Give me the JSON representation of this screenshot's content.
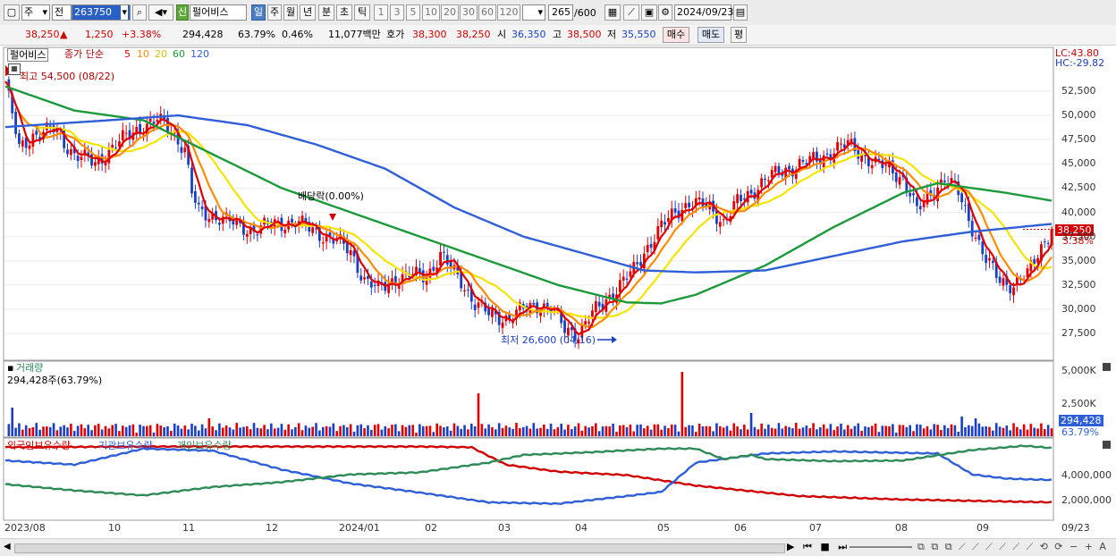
{
  "toolbar": {
    "period_label": "주",
    "prev_label": "전",
    "stock_code": "263750",
    "market_badge": "신",
    "stock_name": "펄어비스",
    "periods": [
      "일",
      "주",
      "월",
      "년",
      "분",
      "초",
      "틱"
    ],
    "numbers": [
      "1",
      "3",
      "5",
      "10",
      "20",
      "30",
      "60",
      "120"
    ],
    "count": "265",
    "count_total": "/600",
    "date": "2024/09/23"
  },
  "quote": {
    "price": "38,250",
    "change": "1,250",
    "change_pct": "+3.38%",
    "volume": "294,428",
    "vol_ratio": "63.79%",
    "turnover": "0.46%",
    "amount": "11,077백만",
    "ask_label": "호가",
    "ask1": "38,300",
    "ask2": "38,250",
    "open_label": "시",
    "open": "36,350",
    "high_label": "고",
    "high": "38,500",
    "low_label": "저",
    "low": "35,550",
    "buy": "매수",
    "sell": "매도",
    "avg": "평"
  },
  "legend": {
    "name": "펄어비스",
    "ma_label": "종가 단순",
    "ma": [
      {
        "period": "5",
        "color": "#e00000"
      },
      {
        "period": "10",
        "color": "#ff8c00"
      },
      {
        "period": "20",
        "color": "#e6d800"
      },
      {
        "period": "60",
        "color": "#1a9a3a"
      },
      {
        "period": "120",
        "color": "#2f5fd8"
      }
    ]
  },
  "annotations": {
    "high": "최고 54,500 (08/22)",
    "low": "최저 26,600 (04/16)",
    "dividend": "배당락(0.00%)",
    "lc": "LC:43.80",
    "hc": "HC:-29.82",
    "cur_price": "38,250",
    "cur_pct": "3.38%"
  },
  "volume_panel": {
    "title": "거래량",
    "value": "294,428주(63.79%)",
    "cur": "294,428",
    "cur_pct": "63.79%",
    "ticks": [
      "5,000K",
      "2,500K"
    ]
  },
  "holdings_panel": {
    "series": [
      {
        "name": "외국인보유수량",
        "color": "#d00000"
      },
      {
        "name": "기관보유수량",
        "color": "#2f5fd8"
      },
      {
        "name": "개인보유수량",
        "color": "#2e8b57"
      }
    ],
    "ticks": [
      "4,000,000",
      "2,000,000"
    ]
  },
  "chart_data": {
    "type": "candlestick",
    "y_ticks": [
      "52,500",
      "50,000",
      "47,500",
      "45,000",
      "42,500",
      "40,000",
      "37,500",
      "35,000",
      "32,500",
      "30,000",
      "27,500"
    ],
    "ylim": [
      25500,
      55000
    ],
    "x_ticks": [
      "2023/08",
      "10",
      "11",
      "12",
      "2024/01",
      "02",
      "03",
      "04",
      "05",
      "06",
      "07",
      "08",
      "09",
      "09/23"
    ],
    "series": [
      {
        "name": "종가",
        "points": [
          [
            0,
            53500
          ],
          [
            4,
            46500
          ],
          [
            8,
            48000
          ],
          [
            14,
            48500
          ],
          [
            20,
            46000
          ],
          [
            26,
            45000
          ],
          [
            32,
            47000
          ],
          [
            38,
            48500
          ],
          [
            44,
            49500
          ],
          [
            48,
            48500
          ],
          [
            52,
            46500
          ],
          [
            54,
            42000
          ],
          [
            56,
            40000
          ],
          [
            62,
            39500
          ],
          [
            68,
            38500
          ],
          [
            72,
            38200
          ],
          [
            78,
            38800
          ],
          [
            84,
            39000
          ],
          [
            90,
            38000
          ],
          [
            96,
            37000
          ],
          [
            100,
            36000
          ],
          [
            104,
            33000
          ],
          [
            108,
            32000
          ],
          [
            112,
            33000
          ],
          [
            118,
            33500
          ],
          [
            122,
            33500
          ],
          [
            126,
            35500
          ],
          [
            132,
            33000
          ],
          [
            136,
            30500
          ],
          [
            140,
            29500
          ],
          [
            146,
            29000
          ],
          [
            150,
            30000
          ],
          [
            154,
            30500
          ],
          [
            158,
            30000
          ],
          [
            162,
            28000
          ],
          [
            166,
            27500
          ],
          [
            170,
            29500
          ],
          [
            174,
            31000
          ],
          [
            178,
            32500
          ],
          [
            182,
            34000
          ],
          [
            186,
            36500
          ],
          [
            190,
            38500
          ],
          [
            194,
            40000
          ],
          [
            198,
            41000
          ],
          [
            204,
            40500
          ],
          [
            208,
            39000
          ],
          [
            212,
            41000
          ],
          [
            216,
            42000
          ],
          [
            220,
            43500
          ],
          [
            224,
            44000
          ],
          [
            230,
            45000
          ],
          [
            236,
            45500
          ],
          [
            240,
            46500
          ],
          [
            244,
            47000
          ],
          [
            248,
            46000
          ],
          [
            252,
            45000
          ],
          [
            256,
            44500
          ],
          [
            260,
            43500
          ],
          [
            262,
            42000
          ],
          [
            264,
            40000
          ],
          [
            268,
            42000
          ],
          [
            272,
            43500
          ],
          [
            276,
            42000
          ],
          [
            280,
            38500
          ],
          [
            284,
            35000
          ],
          [
            288,
            33000
          ],
          [
            292,
            32500
          ],
          [
            296,
            33500
          ],
          [
            300,
            36500
          ],
          [
            303,
            38250
          ]
        ]
      },
      {
        "name": "MA60",
        "points": [
          [
            0,
            53000
          ],
          [
            20,
            50500
          ],
          [
            40,
            49500
          ],
          [
            60,
            46000
          ],
          [
            80,
            42500
          ],
          [
            100,
            40000
          ],
          [
            120,
            37500
          ],
          [
            140,
            35000
          ],
          [
            160,
            32500
          ],
          [
            180,
            30700
          ],
          [
            190,
            30600
          ],
          [
            200,
            31500
          ],
          [
            220,
            34500
          ],
          [
            240,
            38500
          ],
          [
            260,
            42000
          ],
          [
            270,
            43000
          ],
          [
            290,
            42000
          ],
          [
            303,
            41200
          ]
        ]
      },
      {
        "name": "MA120",
        "points": [
          [
            0,
            48800
          ],
          [
            30,
            49500
          ],
          [
            50,
            50000
          ],
          [
            70,
            49000
          ],
          [
            90,
            47000
          ],
          [
            110,
            44500
          ],
          [
            130,
            40500
          ],
          [
            150,
            37500
          ],
          [
            170,
            35500
          ],
          [
            185,
            34000
          ],
          [
            200,
            33800
          ],
          [
            220,
            34000
          ],
          [
            240,
            35500
          ],
          [
            260,
            37000
          ],
          [
            280,
            38000
          ],
          [
            303,
            38800
          ]
        ]
      }
    ],
    "high_point": {
      "label": "최고",
      "value": 54500,
      "date": "08/22"
    },
    "low_point": {
      "label": "최저",
      "value": 26600,
      "date": "04/16"
    }
  }
}
